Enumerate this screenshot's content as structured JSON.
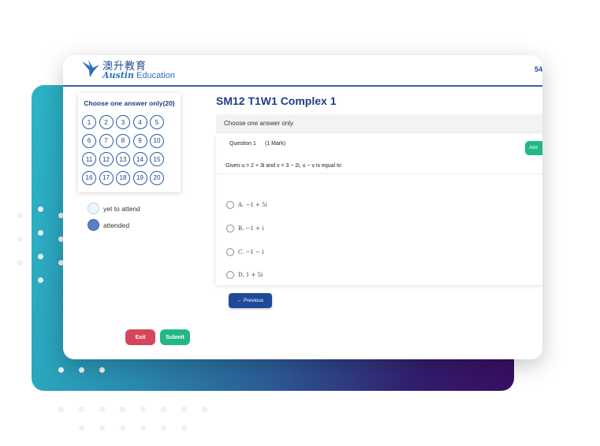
{
  "header": {
    "logo_cn": "澳升教育",
    "logo_en_script": "Austin",
    "logo_en_text": "Education",
    "right_number": "54"
  },
  "sidebar": {
    "title": "Choose one answer only(20)",
    "questions": [
      "1",
      "2",
      "3",
      "4",
      "5",
      "6",
      "7",
      "8",
      "9",
      "10",
      "11",
      "12",
      "13",
      "14",
      "15",
      "16",
      "17",
      "18",
      "19",
      "20"
    ],
    "legend": {
      "yet": "yet to attend",
      "attended": "attended"
    },
    "exit_label": "Exit",
    "submit_label": "Submit"
  },
  "quiz": {
    "title": "SM12 T1W1 Complex 1",
    "instruction": "Choose one answer only",
    "question_label": "Question 1",
    "marks": "(1 Mark)",
    "add_button": "Add",
    "question_text": "Given u = 2 + 3i and v = 3 − 2i, u − v is equal to",
    "options": [
      {
        "label": "A. −1 + 5i"
      },
      {
        "label": "B. −1 + i"
      },
      {
        "label": "C. −1 − i"
      },
      {
        "label": "D. 1 + 5i"
      }
    ],
    "previous_label": "← Previous"
  },
  "colors": {
    "primary": "#1e4a9a",
    "success": "#22b883",
    "danger": "#d6455a"
  }
}
